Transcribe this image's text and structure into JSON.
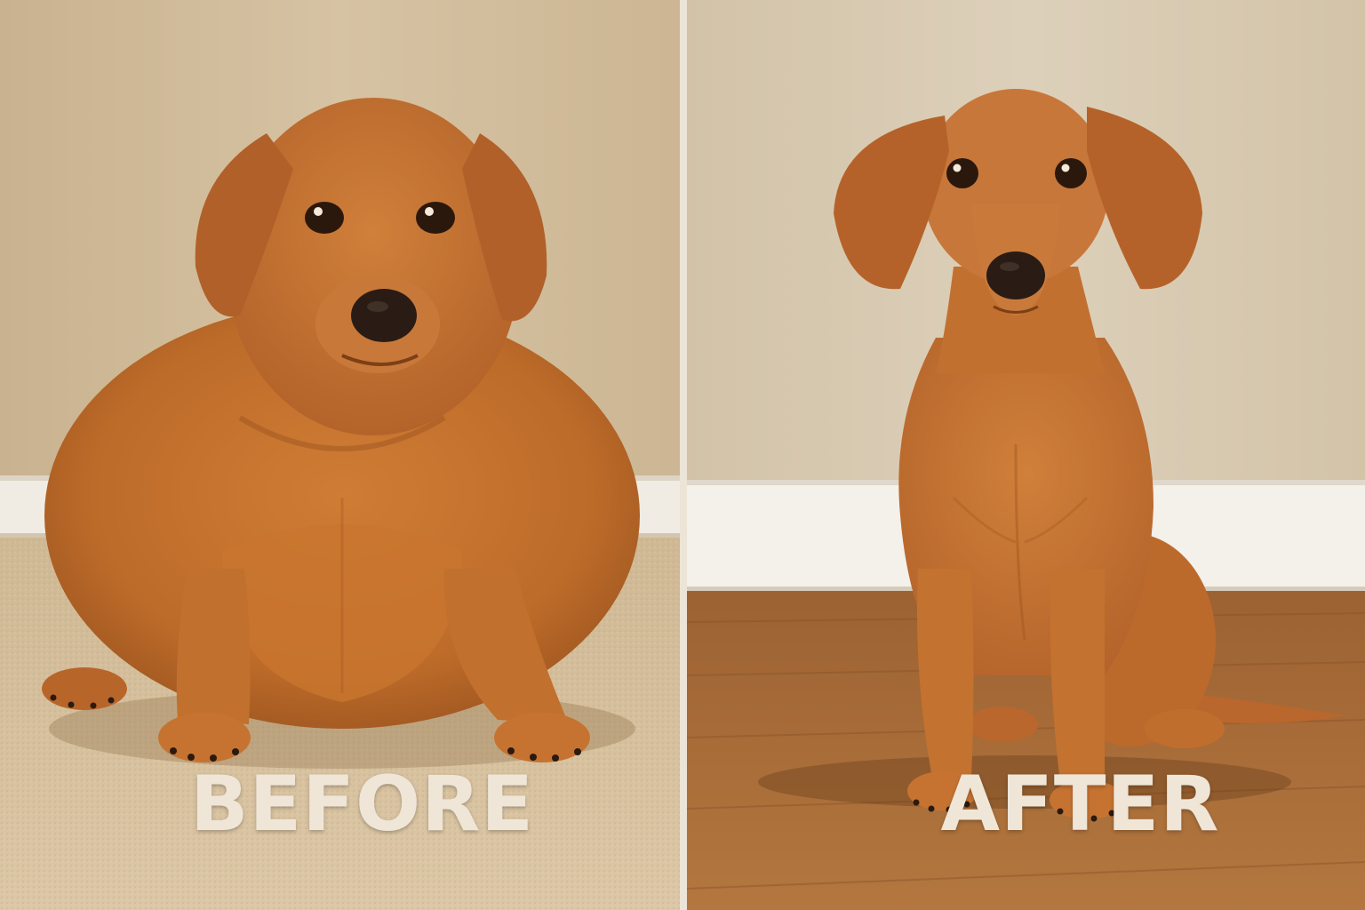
{
  "labels": {
    "before": "BEFORE",
    "after": "AFTER"
  },
  "colors": {
    "caption": "#efe6d8",
    "wall_before": "#d2bd9b",
    "wall_after": "#d8cab2",
    "baseboard": "#f3efe8",
    "carpet": "#d4bd9b",
    "wood_floor": "#a56a36",
    "dog_fur": "#c06f2c",
    "divider": "#ece4d6"
  },
  "icons": {
    "before_subject": "overweight-dachshund",
    "after_subject": "fit-dachshund"
  }
}
